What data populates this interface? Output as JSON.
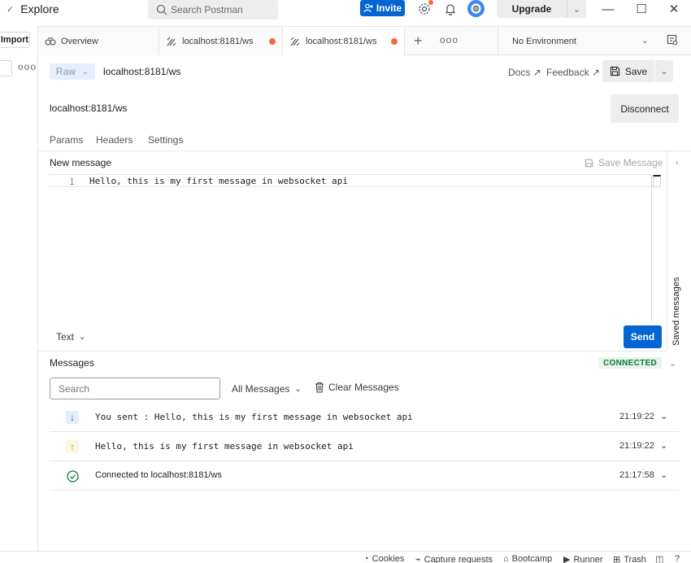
{
  "header": {
    "title": "Explore",
    "search_placeholder": "Search Postman",
    "invite_label": "Invite",
    "upgrade_label": "Upgrade"
  },
  "sidebar": {
    "import_label": "Import",
    "more": "ooo"
  },
  "tabs": [
    {
      "label": "Overview",
      "icon": "overview-icon"
    },
    {
      "label": "localhost:8181/ws",
      "icon": "websocket-icon",
      "unsaved": true
    },
    {
      "label": "localhost:8181/ws",
      "icon": "websocket-icon",
      "unsaved": true,
      "active": true
    }
  ],
  "tab_more": "ooo",
  "environment": {
    "label": "No Environment"
  },
  "request": {
    "mode_label": "Raw",
    "title": "localhost:8181/ws",
    "docs_label": "Docs ↗",
    "feedback_label": "Feedback ↗",
    "save_label": "Save",
    "url": "localhost:8181/ws",
    "disconnect_label": "Disconnect"
  },
  "subtabs": [
    "Params",
    "Headers",
    "Settings"
  ],
  "composer": {
    "title": "New message",
    "save_message_label": "Save Message",
    "line_number": "1",
    "code": "Hello, this is my first message in websocket api",
    "format_label": "Text",
    "send_label": "Send",
    "saved_messages_label": "Saved messages"
  },
  "messages": {
    "title": "Messages",
    "status": "CONNECTED",
    "search_placeholder": "Search",
    "filter_label": "All Messages",
    "clear_label": "Clear Messages",
    "items": [
      {
        "direction": "incoming",
        "icon": "arrow-down-icon",
        "text": "You sent : Hello, this is my first message in websocket api",
        "time": "21:19:22"
      },
      {
        "direction": "outgoing",
        "icon": "arrow-up-icon",
        "text": "Hello, this is my first message in websocket api",
        "time": "21:19:22"
      },
      {
        "direction": "event",
        "icon": "check-circle-icon",
        "text": "Connected to localhost:8181/ws",
        "time": "21:17:58"
      }
    ]
  },
  "statusbar": {
    "cookies": "Cookies",
    "capture": "Capture requests",
    "bootcamp": "Bootcamp",
    "runner": "Runner",
    "trash": "Trash"
  },
  "colors": {
    "accent": "#0265d2",
    "unsaved_dot": "#f26b3a",
    "connected_green": "#0a7a3a",
    "connected_bg": "#e6f4ea"
  }
}
